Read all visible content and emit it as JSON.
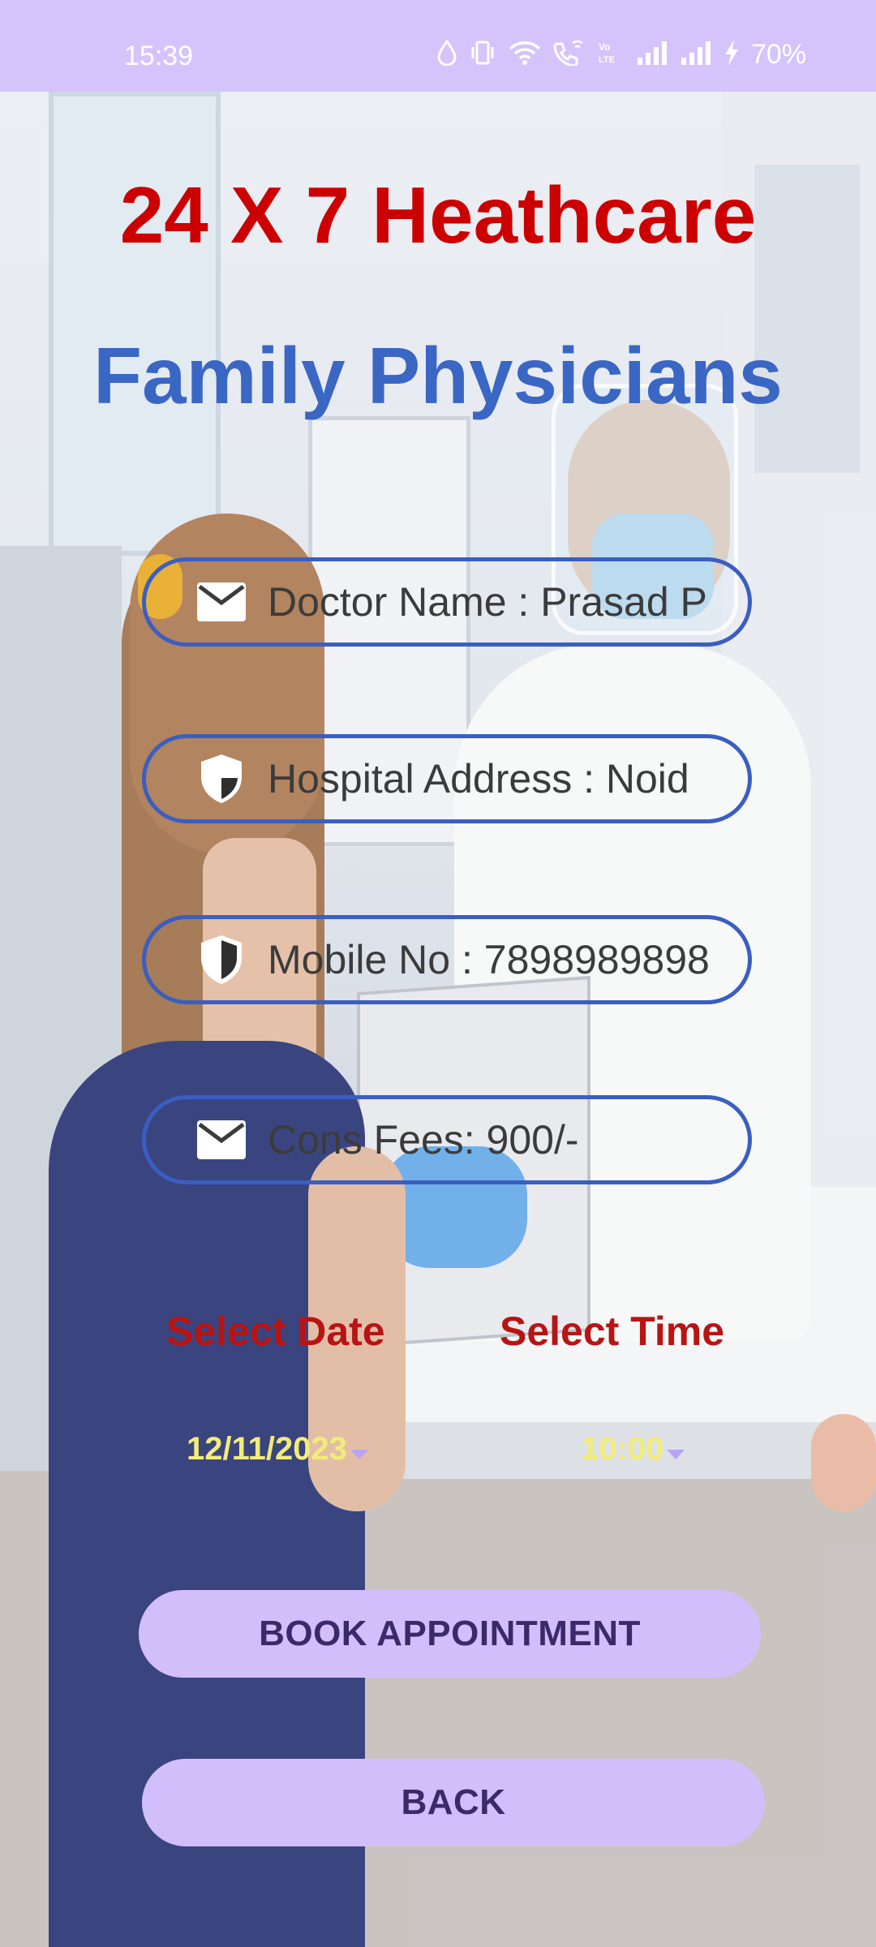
{
  "status_bar": {
    "time": "15:39",
    "battery": "70%",
    "icons": [
      "water-drop-icon",
      "vibrate-icon",
      "wifi-icon",
      "wifi-calling-icon",
      "volte-icon",
      "signal-icon",
      "signal-icon",
      "charging-bolt-icon"
    ]
  },
  "header": {
    "title": "24 X 7 Heathcare",
    "subtitle": "Family Physicians"
  },
  "fields": {
    "doctor_name": "Doctor Name : Prasad P",
    "hospital_address": "Hospital Address : Noid",
    "mobile_no": "Mobile No : 7898989898",
    "cons_fees": "Cons Fees: 900/-"
  },
  "schedule": {
    "date_label": "Select Date",
    "time_label": "Select Time",
    "date_value": "12/11/2023",
    "time_value": "10:00"
  },
  "buttons": {
    "book": "BOOK APPOINTMENT",
    "back": "BACK"
  },
  "colors": {
    "status_bar_bg": "#d4c4fb",
    "title_red": "#cc0000",
    "subtitle_blue": "#3a66c4",
    "field_border": "#3a5ec2",
    "label_red": "#b81414",
    "picker_yellow": "#f2ec78",
    "button_bg": "#d3befc",
    "button_text": "#3b2a6b"
  }
}
